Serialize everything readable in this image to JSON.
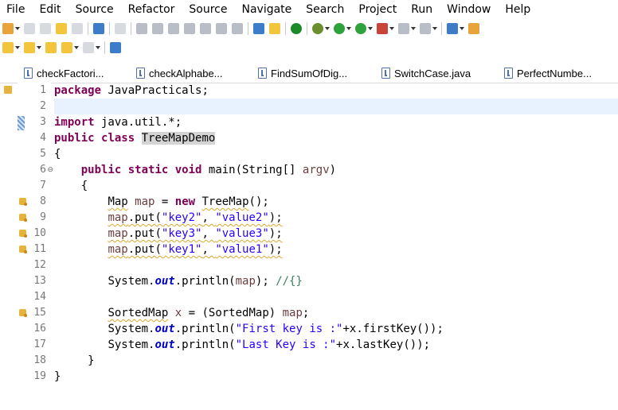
{
  "menu": {
    "items": [
      "File",
      "Edit",
      "Source",
      "Refactor",
      "Source",
      "Navigate",
      "Search",
      "Project",
      "Run",
      "Window",
      "Help"
    ]
  },
  "toolbar": {
    "icons": [
      "new-icon",
      "save-icon",
      "save-all-icon",
      "undo-icon",
      "redo-icon",
      "terminal-icon",
      "skip-breakpoints-icon",
      "resume-icon",
      "suspend-icon",
      "terminate-icon",
      "step-into-icon",
      "step-over-icon",
      "step-return-icon",
      "drop-to-frame-icon",
      "open-type-icon",
      "task-icon",
      "ant-icon",
      "debug-icon",
      "run-icon",
      "coverage-icon",
      "external-tools-icon",
      "stop-icon",
      "server-icon",
      "new-java-icon",
      "search-icon"
    ]
  },
  "tabs": [
    {
      "label": "checkFactori..."
    },
    {
      "label": "checkAlphabe..."
    },
    {
      "label": "FindSumOfDig..."
    },
    {
      "label": "SwitchCase.java"
    },
    {
      "label": "PerfectNumbe..."
    }
  ],
  "editor": {
    "line_numbers": [
      "1",
      "2",
      "3",
      "4",
      "5",
      "6",
      "7",
      "8",
      "9",
      "10",
      "11",
      "12",
      "13",
      "14",
      "15",
      "16",
      "17",
      "18",
      "19"
    ],
    "code": {
      "l1_kw": "package",
      "l1_rest": " JavaPracticals;",
      "l3_kw": "import",
      "l3_rest": " java.util.*;",
      "l4_kw1": "public",
      "l4_kw2": "class",
      "l4_name": "TreeMapDemo",
      "l5": "{",
      "l6_kw1": "public",
      "l6_kw2": "static",
      "l6_kw3": "void",
      "l6_rest": " main(String[] ",
      "l6_var": "argv",
      "l6_end": ")",
      "l7": "    {",
      "l8_map": "Map",
      "l8_var": "map",
      "l8_eq": " = ",
      "l8_new": "new",
      "l8_ctor": "TreeMap",
      "l8_end": "();",
      "l9_var": "map",
      "l9_put": ".put(",
      "l9_s1": "\"key2\"",
      "l9_sep": ", ",
      "l9_s2": "\"value2\"",
      "l9_end": ");",
      "l10_var": "map",
      "l10_put": ".put(",
      "l10_s1": "\"key3\"",
      "l10_sep": ", ",
      "l10_s2": "\"value3\"",
      "l10_end": ");",
      "l11_var": "map",
      "l11_put": ".put(",
      "l11_s1": "\"key1\"",
      "l11_sep": ", ",
      "l11_s2": "\"value1\"",
      "l11_end": ");",
      "l13_sys": "System.",
      "l13_out": "out",
      "l13_call": ".println(",
      "l13_var": "map",
      "l13_end": "); ",
      "l13_cmt": "//{}",
      "l15_type": "SortedMap",
      "l15_var": "x",
      "l15_mid": " = (SortedMap) ",
      "l15_var2": "map",
      "l15_end": ";",
      "l16_sys": "System.",
      "l16_out": "out",
      "l16_call": ".println(",
      "l16_str": "\"First key is :\"",
      "l16_end": "+x.firstKey());",
      "l17_sys": "System.",
      "l17_out": "out",
      "l17_call": ".println(",
      "l17_str": "\"Last Key is :\"",
      "l17_end": "+x.lastKey());",
      "l18": "     }",
      "l19": "}"
    }
  }
}
